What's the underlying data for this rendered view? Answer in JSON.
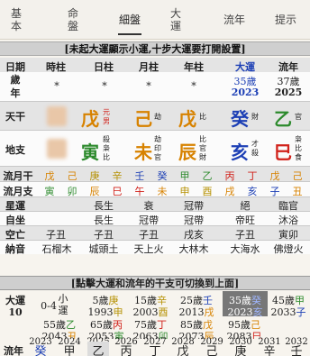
{
  "nav": {
    "items": [
      "基\n本",
      "命\n盤",
      "細盤",
      "大\n運",
      "流年",
      "提示"
    ]
  },
  "notice": "[未起大運顯示小運,十步大運要打開設置]",
  "headers": [
    "日期",
    "時柱",
    "日柱",
    "月柱",
    "年柱",
    "大運",
    "流年"
  ],
  "age": {
    "label": "歲\n年",
    "star": "*",
    "dayun_age": "35歲",
    "dayun_year": "2023",
    "liunian_age": "37歲",
    "liunian_year": "2025"
  },
  "tiangan": {
    "label": "天干",
    "day": {
      "char": "戊",
      "tag1": "元",
      "tag2": "男"
    },
    "month": {
      "char": "己",
      "tag": "劫"
    },
    "year": {
      "char": "戊",
      "tag": "比"
    },
    "dayun": {
      "char": "癸",
      "tag": "財"
    },
    "liunian": {
      "char": "乙",
      "tag": "官"
    }
  },
  "dizhi": {
    "label": "地支",
    "day": {
      "char": "寅",
      "tags": [
        "殺",
        "枭",
        "比"
      ]
    },
    "month": {
      "char": "未",
      "tags": [
        "劫",
        "印",
        "官"
      ]
    },
    "year": {
      "char": "辰",
      "tags": [
        "比",
        "官",
        "財"
      ]
    },
    "dayun": {
      "char": "亥",
      "tags": [
        "才",
        "殺"
      ]
    },
    "liunian": {
      "char": "巳",
      "tags": [
        "枭",
        "比",
        "食"
      ]
    }
  },
  "liuyue_gan": {
    "label": "流月干",
    "chars": [
      "戊",
      "己",
      "庚",
      "辛",
      "壬",
      "癸",
      "甲",
      "乙",
      "丙",
      "丁",
      "戊",
      "己"
    ]
  },
  "liuyue_zhi": {
    "label": "流月支",
    "chars": [
      "寅",
      "卯",
      "辰",
      "巳",
      "午",
      "未",
      "申",
      "酉",
      "戌",
      "亥",
      "子",
      "丑"
    ]
  },
  "xingyun": {
    "label": "星運",
    "day": "長生",
    "month": "衰",
    "year": "冠帶",
    "dayun": "絕",
    "liunian": "臨官"
  },
  "zizuo": {
    "label": "自坐",
    "day": "長生",
    "month": "冠帶",
    "year": "冠帶",
    "dayun": "帝旺",
    "liunian": "沐浴"
  },
  "kongwang": {
    "label": "空亡",
    "time": "子丑",
    "day": "子丑",
    "month": "子丑",
    "year": "戌亥",
    "dayun": "子丑",
    "liunian": "寅卯"
  },
  "nayin": {
    "label": "納音",
    "time": "石榴木",
    "day": "城頭土",
    "month": "天上火",
    "year": "大林木",
    "dayun": "大海水",
    "liunian": "佛燈火"
  },
  "sec2": "[點擊大運和流年的干支可切換到上面]",
  "dayun_section": {
    "label": "大運",
    "start": "10",
    "xiaoyun": "0-4",
    "xiaoyun_label": "小\n運",
    "items": [
      {
        "age": "5歲",
        "gan": "庚",
        "year": "1993",
        "zhi": "申"
      },
      {
        "age": "15歲",
        "gan": "辛",
        "year": "2003",
        "zhi": "酉"
      },
      {
        "age": "25歲",
        "gan": "壬",
        "year": "2013",
        "zhi": "戌"
      },
      {
        "age": "35歲",
        "gan": "癸",
        "year": "2023",
        "zhi": "亥"
      },
      {
        "age": "45歲",
        "gan": "甲",
        "year": "2033",
        "zhi": "子"
      },
      {
        "age": "55歲",
        "gan": "乙",
        "year": "2043",
        "zhi": "丑"
      },
      {
        "age": "65歲",
        "gan": "丙",
        "year": "2053",
        "zhi": "寅"
      },
      {
        "age": "75歲",
        "gan": "丁",
        "year": "2063",
        "zhi": "卯"
      },
      {
        "age": "85歲",
        "gan": "戊",
        "year": "2073",
        "zhi": "辰"
      },
      {
        "age": "95歲",
        "gan": "己",
        "year": "2083",
        "zhi": "巳"
      }
    ]
  },
  "years": [
    "2023",
    "2024",
    "2025",
    "2026",
    "2027",
    "2028",
    "2029",
    "2030",
    "2031",
    "2032"
  ],
  "liunian_row": {
    "label": "流年",
    "chars": [
      "癸",
      "甲",
      "乙",
      "丙",
      "丁",
      "戊",
      "己",
      "庚",
      "辛",
      "壬"
    ]
  }
}
